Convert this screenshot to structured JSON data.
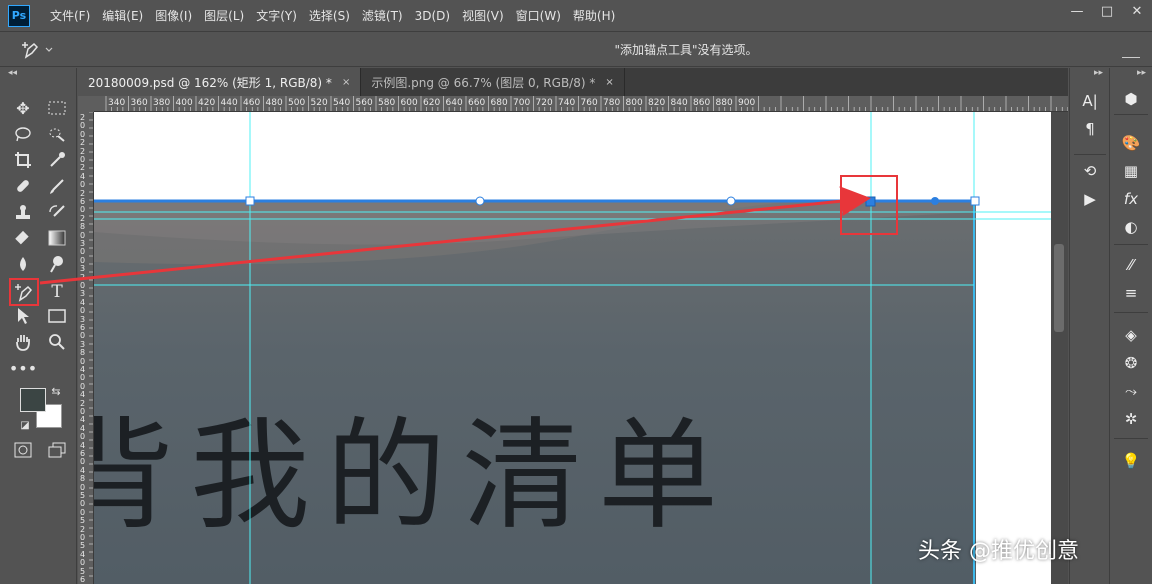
{
  "app": {
    "logo": "Ps"
  },
  "menu": [
    "文件(F)",
    "编辑(E)",
    "图像(I)",
    "图层(L)",
    "文字(Y)",
    "选择(S)",
    "滤镜(T)",
    "3D(D)",
    "视图(V)",
    "窗口(W)",
    "帮助(H)"
  ],
  "window_controls": {
    "minimize": "—",
    "restore": "□",
    "close": "✕"
  },
  "options_bar": {
    "tool_icon": "pen-plus-icon",
    "message": "\"添加锚点工具\"没有选项。"
  },
  "tabs": [
    {
      "label": "20180009.psd @ 162% (矩形 1, RGB/8) *",
      "close": "×",
      "active": true
    },
    {
      "label": "示例图.png @ 66.7% (图层 0, RGB/8) *",
      "close": "×",
      "active": false
    }
  ],
  "ruler": {
    "top_labels": [
      "340",
      "360",
      "380",
      "400",
      "420",
      "440",
      "460",
      "480",
      "500",
      "520",
      "540",
      "560",
      "580",
      "600",
      "620",
      "640",
      "660",
      "680",
      "700",
      "720",
      "740",
      "760",
      "780",
      "800",
      "820",
      "840",
      "860",
      "880",
      "900"
    ],
    "left_labels": [
      "2",
      "0",
      "0",
      "2",
      "2",
      "0",
      "2",
      "4",
      "0",
      "2",
      "6",
      "0",
      "2",
      "8",
      "0",
      "3",
      "0",
      "0",
      "3",
      "2",
      "0",
      "3",
      "4",
      "0",
      "3",
      "6",
      "0",
      "3",
      "8",
      "0",
      "4",
      "0",
      "0",
      "4",
      "2",
      "0",
      "4",
      "4",
      "0",
      "4",
      "6",
      "0",
      "4",
      "8",
      "0",
      "5",
      "0",
      "0",
      "5",
      "2",
      "0",
      "5",
      "4",
      "0",
      "5",
      "6"
    ]
  },
  "canvas": {
    "artwork_text": "背我的清单",
    "colors": {
      "shape": "#56626a",
      "path": "#2b7fe0",
      "guide": "#4ff0f5",
      "highlight": "#e8363a"
    }
  },
  "colors": {
    "foreground": "#3b4544",
    "background": "#ffffff"
  },
  "watermark": "头条 @推优创意"
}
